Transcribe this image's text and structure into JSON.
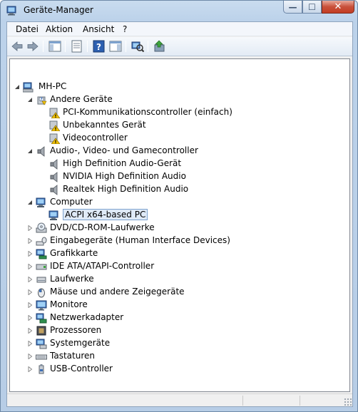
{
  "window": {
    "title": "Geräte-Manager",
    "minimize_glyph": "—",
    "maximize_glyph": "☐",
    "close_glyph": "✕"
  },
  "menu": {
    "items": [
      "Datei",
      "Aktion",
      "Ansicht",
      "?"
    ]
  },
  "toolbar": {
    "buttons": [
      {
        "icon": "back-arrow-icon"
      },
      {
        "icon": "forward-arrow-icon"
      },
      {
        "icon": "show-hide-console-tree-icon"
      },
      {
        "icon": "properties-icon"
      },
      {
        "icon": "help-icon"
      },
      {
        "icon": "show-action-pane-icon"
      },
      {
        "icon": "scan-hardware-icon"
      },
      {
        "icon": "update-driver-icon"
      }
    ]
  },
  "tree": {
    "root": "MH-PC",
    "nodes": [
      {
        "label": "Andere Geräte",
        "state": "expanded",
        "icon": "unknown-device-icon"
      },
      {
        "label": "PCI-Kommunikationscontroller (einfach)",
        "state": "leaf",
        "icon": "warning-device-icon"
      },
      {
        "label": "Unbekanntes Gerät",
        "state": "leaf",
        "icon": "warning-device-icon"
      },
      {
        "label": "Videocontroller",
        "state": "leaf",
        "icon": "warning-device-icon"
      },
      {
        "label": "Audio-, Video- und Gamecontroller",
        "state": "expanded",
        "icon": "speaker-icon"
      },
      {
        "label": "High Definition Audio-Gerät",
        "state": "leaf",
        "icon": "speaker-icon"
      },
      {
        "label": "NVIDIA High Definition Audio",
        "state": "leaf",
        "icon": "speaker-icon"
      },
      {
        "label": "Realtek High Definition Audio",
        "state": "leaf",
        "icon": "speaker-icon"
      },
      {
        "label": "Computer",
        "state": "expanded",
        "icon": "computer-icon"
      },
      {
        "label": "ACPI x64-based PC",
        "state": "leaf",
        "icon": "computer-icon",
        "selected": true
      },
      {
        "label": "DVD/CD-ROM-Laufwerke",
        "state": "collapsed",
        "icon": "dvd-drive-icon"
      },
      {
        "label": "Eingabegeräte (Human Interface Devices)",
        "state": "collapsed",
        "icon": "hid-icon"
      },
      {
        "label": "Grafikkarte",
        "state": "collapsed",
        "icon": "display-adapter-icon"
      },
      {
        "label": "IDE ATA/ATAPI-Controller",
        "state": "collapsed",
        "icon": "ide-controller-icon"
      },
      {
        "label": "Laufwerke",
        "state": "collapsed",
        "icon": "disk-drive-icon"
      },
      {
        "label": "Mäuse und andere Zeigegeräte",
        "state": "collapsed",
        "icon": "mouse-icon"
      },
      {
        "label": "Monitore",
        "state": "collapsed",
        "icon": "monitor-icon"
      },
      {
        "label": "Netzwerkadapter",
        "state": "collapsed",
        "icon": "network-adapter-icon"
      },
      {
        "label": "Prozessoren",
        "state": "collapsed",
        "icon": "processor-icon"
      },
      {
        "label": "Systemgeräte",
        "state": "collapsed",
        "icon": "system-devices-icon"
      },
      {
        "label": "Tastaturen",
        "state": "collapsed",
        "icon": "keyboard-icon"
      },
      {
        "label": "USB-Controller",
        "state": "collapsed",
        "icon": "usb-controller-icon"
      }
    ]
  },
  "colors": {
    "titlebar": "#c9dcef",
    "selection": "#dfeaf7",
    "warning": "#f2c200",
    "close_button": "#c33d23"
  }
}
